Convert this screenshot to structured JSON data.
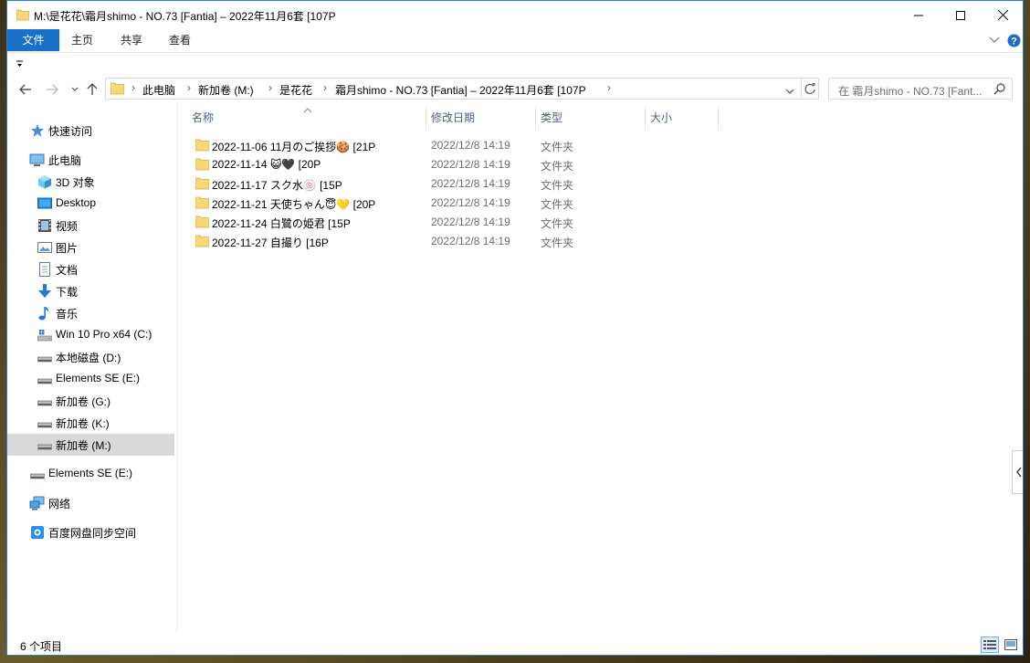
{
  "window": {
    "title": "M:\\是花花\\霜月shimo - NO.73 [Fantia] – 2022年11月6套 [107P"
  },
  "ribbon": {
    "tabs": [
      "文件",
      "主页",
      "共享",
      "查看"
    ]
  },
  "address": {
    "crumbs": [
      "此电脑",
      "新加卷 (M:)",
      "是花花",
      "霜月shimo - NO.73 [Fantia] – 2022年11月6套 [107P"
    ]
  },
  "search": {
    "placeholder": "在 霜月shimo - NO.73 [Fant..."
  },
  "sidebar": {
    "items": [
      {
        "label": "快速访问",
        "icon": "star-icon"
      },
      {
        "label": "此电脑",
        "icon": "pc-icon"
      },
      {
        "label": "3D 对象",
        "icon": "cube-icon"
      },
      {
        "label": "Desktop",
        "icon": "desktop-icon"
      },
      {
        "label": "视频",
        "icon": "video-icon"
      },
      {
        "label": "图片",
        "icon": "picture-icon"
      },
      {
        "label": "文档",
        "icon": "document-icon"
      },
      {
        "label": "下载",
        "icon": "download-icon"
      },
      {
        "label": "音乐",
        "icon": "music-icon"
      },
      {
        "label": "Win 10 Pro x64 (C:)",
        "icon": "system-drive-icon"
      },
      {
        "label": "本地磁盘 (D:)",
        "icon": "drive-icon"
      },
      {
        "label": "Elements SE (E:)",
        "icon": "drive-icon"
      },
      {
        "label": "新加卷 (G:)",
        "icon": "drive-icon"
      },
      {
        "label": "新加卷 (K:)",
        "icon": "drive-icon"
      },
      {
        "label": "新加卷 (M:)",
        "icon": "drive-icon"
      },
      {
        "label": "Elements SE (E:)",
        "icon": "drive-icon"
      },
      {
        "label": "网络",
        "icon": "network-icon"
      },
      {
        "label": "百度网盘同步空间",
        "icon": "baidu-cloud-icon"
      }
    ]
  },
  "columns": {
    "name": "名称",
    "date": "修改日期",
    "type": "类型",
    "size": "大小"
  },
  "files": [
    {
      "name": "2022-11-06 11月のご挨拶🍪 [21P",
      "date": "2022/12/8 14:19",
      "type": "文件夹"
    },
    {
      "name": "2022-11-14 😺🖤 [20P",
      "date": "2022/12/8 14:19",
      "type": "文件夹"
    },
    {
      "name": "2022-11-17 スク水🍥 [15P",
      "date": "2022/12/8 14:19",
      "type": "文件夹"
    },
    {
      "name": "2022-11-21 天使ちゃん😇💛 [20P",
      "date": "2022/12/8 14:19",
      "type": "文件夹"
    },
    {
      "name": "2022-11-24 白鷺の姫君 [15P",
      "date": "2022/12/8 14:19",
      "type": "文件夹"
    },
    {
      "name": "2022-11-27 自撮り [16P",
      "date": "2022/12/8 14:19",
      "type": "文件夹"
    }
  ],
  "status": {
    "count": "6 个项目"
  },
  "colors": {
    "accent": "#1a6fc8",
    "folder": "#f8d775",
    "selected": "#d9d9d9"
  }
}
